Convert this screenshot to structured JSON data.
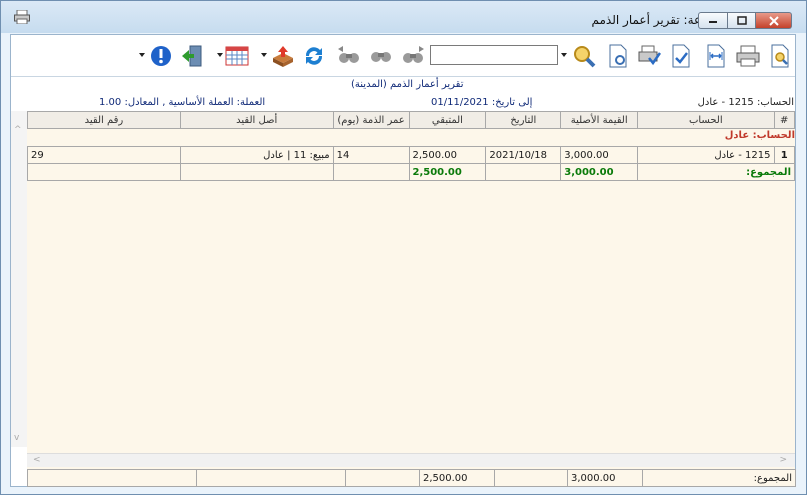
{
  "window": {
    "title": "طباعة: تقرير أعمار الذمم"
  },
  "toolbar": {
    "search_value": "",
    "icons": [
      "preview-icon",
      "print-icon",
      "fit-width-icon",
      "report-check-icon",
      "print-setup-icon",
      "page-setup-icon",
      "zoom-icon",
      "search-dropdown",
      "binoculars-icon",
      "find-next-icon",
      "find-prev-icon",
      "refresh-icon",
      "export-icon",
      "calendar-icon",
      "exit-icon",
      "info-icon"
    ]
  },
  "report": {
    "title": "تقرير أعمار الذمم (المدينة)",
    "account_label": "الحساب: 1215 - عادل",
    "to_date_label": "إلى تاريخ: 01/11/2021",
    "currency_label": "العملة: العملة الأساسية , المعادل: 1.00"
  },
  "table": {
    "columns": [
      "#",
      "الحساب",
      "القيمة الأصلية",
      "التاريخ",
      "المتبقي",
      "عمر الذمة (يوم)",
      "أصل القيد",
      "رقم القيد"
    ],
    "group_label": "الحساب: عادل",
    "rows": [
      {
        "index": "1",
        "account": "1215 - عادل",
        "original": "3,000.00",
        "date": "2021/10/18",
        "remaining": "2,500.00",
        "age": "14",
        "origin": "مبيع: 11 | عادل",
        "entry_no": "29"
      }
    ],
    "subtotal": {
      "label": "المجموع:",
      "original": "3,000.00",
      "remaining": "2,500.00"
    }
  },
  "footer": {
    "label": "المجموع:",
    "original": "3,000.00",
    "remaining": "2,500.00"
  },
  "colors": {
    "title_blue": "#102a78",
    "group_red": "#c0392b",
    "total_green": "#0a7a0a",
    "grid_bg": "#fdf7ea"
  }
}
